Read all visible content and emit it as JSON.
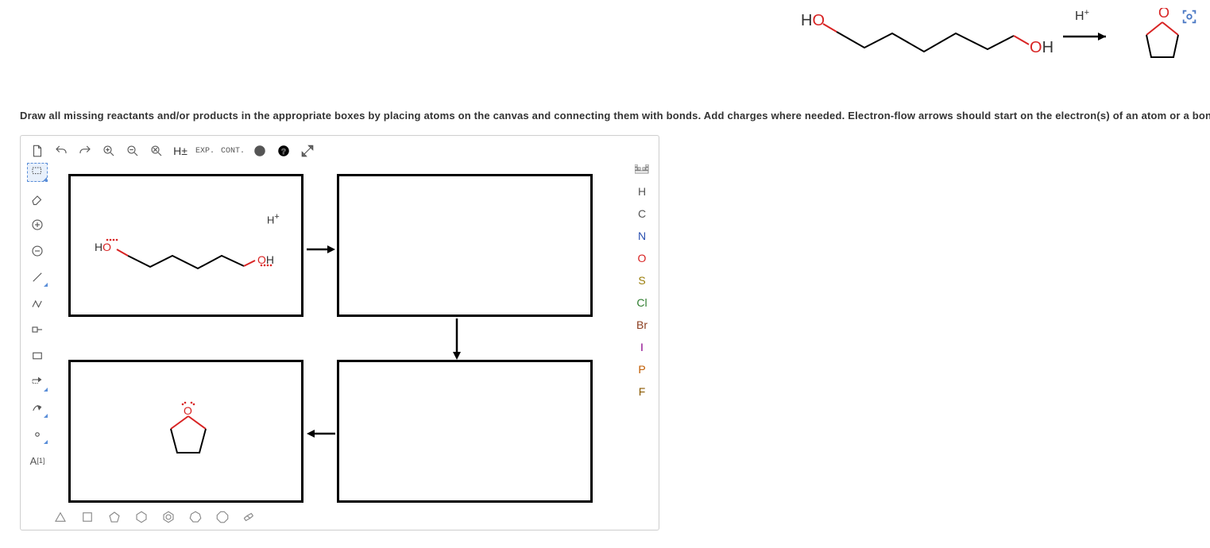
{
  "instruction": "Draw all missing reactants and/or products in the appropriate boxes by placing atoms on the canvas and connecting them with bonds. Add charges where needed. Electron-flow arrows should start on the electron(s) of an atom or a bond and s",
  "top_scheme": {
    "reagent_label": "H⁺",
    "reactant_labels": [
      "HO",
      "OH"
    ],
    "product_label": "O"
  },
  "toolbar_top": {
    "new": "new",
    "undo": "undo",
    "redo": "redo",
    "zoom_in": "zoom in",
    "zoom_out": "zoom out",
    "zoom_fit": "zoom fit",
    "h_toggle": "H±",
    "exp": "EXP.",
    "cont": "CONT.",
    "info": "info",
    "help": "help",
    "fullscreen": "fullscreen"
  },
  "sidebar_left": {
    "marquee": "marquee",
    "erase": "erase",
    "charge_plus": "+",
    "charge_minus": "−",
    "single_bond": "single",
    "multi_bond": "multi",
    "chain": "chain",
    "frame": "frame",
    "rxn_arrow": "reaction arrow",
    "mech_arrow": "mechanism arrow",
    "lone_pair": "lone pair",
    "map": "A[1]"
  },
  "elements": [
    "H",
    "C",
    "N",
    "O",
    "S",
    "Cl",
    "Br",
    "I",
    "P",
    "F"
  ],
  "shapes_bottom": [
    "triangle",
    "square",
    "pentagon",
    "hexagon",
    "benzene",
    "cycloheptane",
    "cyclooctane",
    "chair"
  ],
  "boxes": {
    "box1": {
      "labels": [
        "HO",
        "OH"
      ],
      "reagent": "H⁺"
    },
    "box4_label": "O"
  }
}
